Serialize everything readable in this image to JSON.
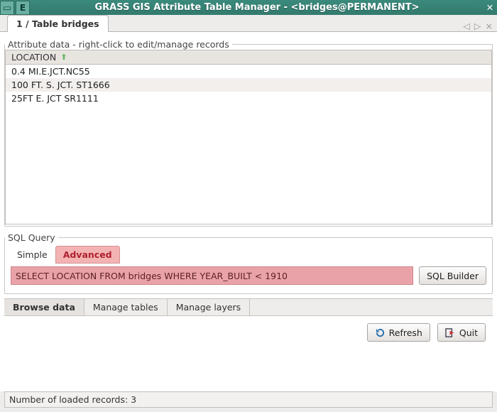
{
  "window": {
    "title": "GRASS GIS Attribute Table Manager - <bridges@PERMANENT>"
  },
  "top_tabs": {
    "active_label": "1 / Table bridges"
  },
  "grid": {
    "legend": "Attribute data - right-click to edit/manage records",
    "column_header": "LOCATION",
    "rows": [
      "0.4 MI.E.JCT.NC55",
      "100 FT. S. JCT. ST1666",
      "25FT E. JCT SR1111"
    ]
  },
  "sql": {
    "legend": "SQL Query",
    "tabs": {
      "simple": "Simple",
      "advanced": "Advanced"
    },
    "query_value": "SELECT LOCATION FROM bridges WHERE YEAR_BUILT < 1910",
    "builder_label": "SQL Builder"
  },
  "bottom_tabs": {
    "browse": "Browse data",
    "manage_tables": "Manage tables",
    "manage_layers": "Manage layers"
  },
  "actions": {
    "refresh": "Refresh",
    "quit": "Quit"
  },
  "status": {
    "text": "Number of loaded records: 3"
  }
}
